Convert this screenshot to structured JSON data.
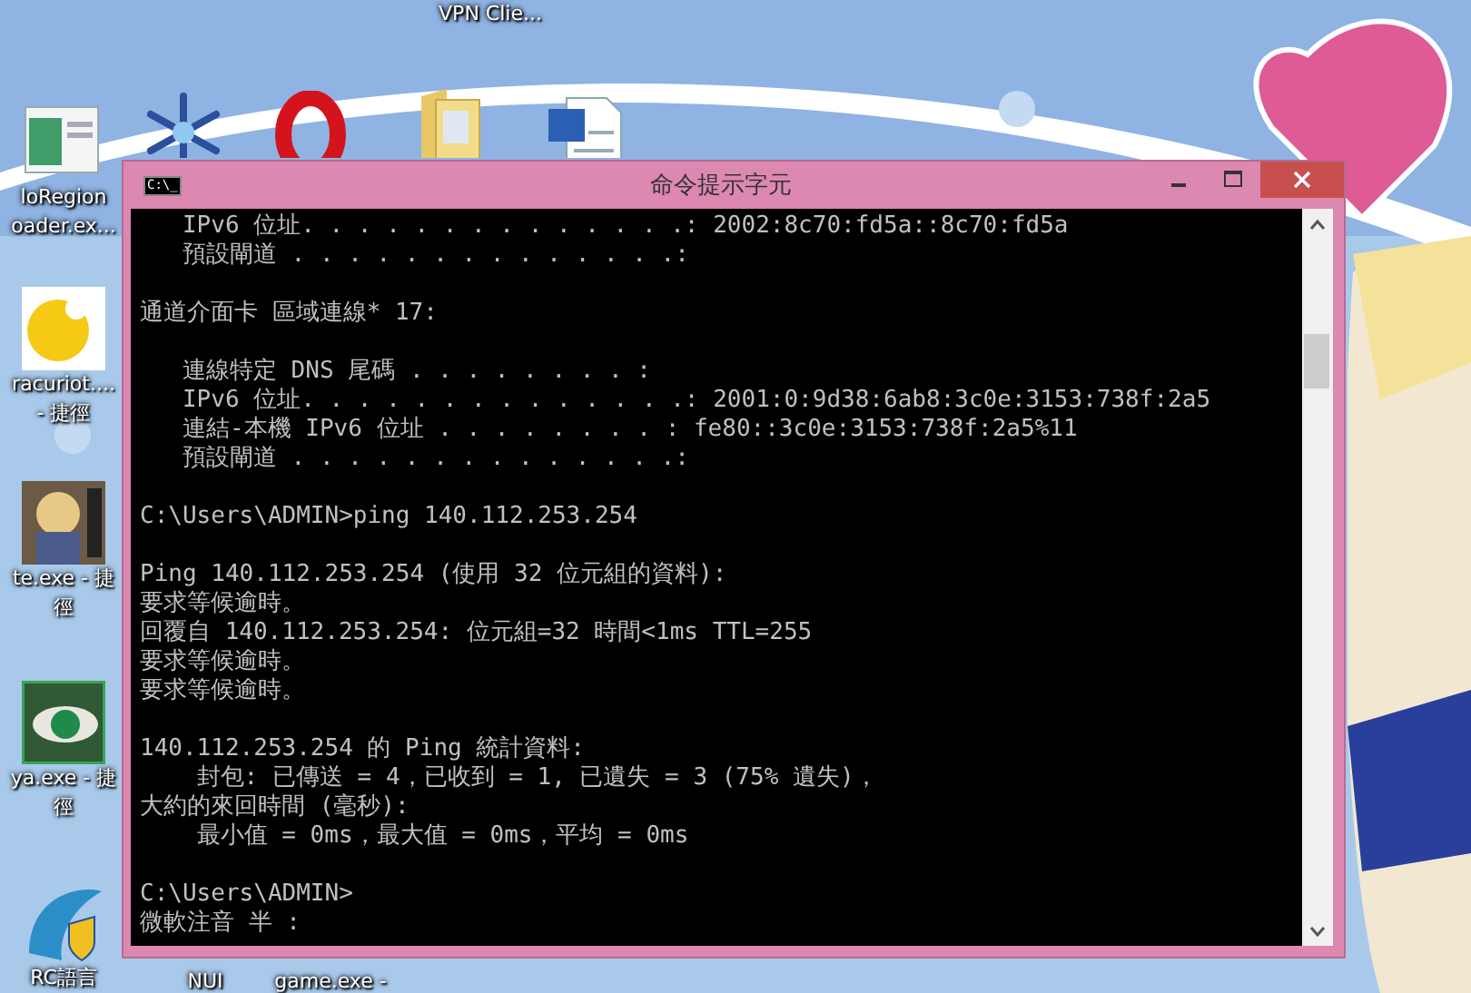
{
  "desktop": {
    "icons": [
      {
        "kind": "none",
        "label": [
          "VPN Clie..."
        ]
      },
      {
        "kind": "window",
        "label": [
          "loRegion",
          "oader.ex..."
        ]
      },
      {
        "kind": "snowflake"
      },
      {
        "kind": "ring"
      },
      {
        "kind": "folder"
      },
      {
        "kind": "document"
      },
      {
        "kind": "orange",
        "label": [
          "racuriot....",
          "- 捷徑"
        ]
      },
      {
        "kind": "portrait",
        "label": [
          "te.exe - 捷",
          "徑"
        ]
      },
      {
        "kind": "eye",
        "label": [
          "ya.exe - 捷",
          "徑"
        ]
      },
      {
        "kind": "shield",
        "label": [
          "RC語言"
        ]
      },
      {
        "kind": "none",
        "label": [
          "NUI"
        ]
      },
      {
        "kind": "none",
        "label": [
          "game.exe -"
        ]
      }
    ]
  },
  "window": {
    "title": "命令提示字元",
    "icon_text": "C:\\_",
    "console": {
      "blocks": [
        [
          "   IPv6 位址. . . . . . . . . . . . . .: 2002:8c70:fd5a::8c70:fd5a",
          "   預設閘道 . . . . . . . . . . . . . .:"
        ],
        [
          "通道介面卡 區域連線* 17:"
        ],
        [
          "   連線特定 DNS 尾碼 . . . . . . . . :",
          "   IPv6 位址. . . . . . . . . . . . . .: 2001:0:9d38:6ab8:3c0e:3153:738f:2a5",
          "   連結-本機 IPv6 位址 . . . . . . . . : fe80::3c0e:3153:738f:2a5%11",
          "   預設閘道 . . . . . . . . . . . . . .:"
        ],
        [
          "C:\\Users\\ADMIN>ping 140.112.253.254"
        ],
        [
          "Ping 140.112.253.254 (使用 32 位元組的資料):",
          "要求等候逾時。",
          "回覆自 140.112.253.254: 位元組=32 時間<1ms TTL=255",
          "要求等候逾時。",
          "要求等候逾時。"
        ],
        [
          "140.112.253.254 的 Ping 統計資料:",
          "    封包: 已傳送 = 4，已收到 = 1, 已遺失 = 3 (75% 遺失)，",
          "大約的來回時間 (毫秒):",
          "    最小值 = 0ms，最大值 = 0ms，平均 = 0ms"
        ],
        [
          "C:\\Users\\ADMIN>"
        ]
      ],
      "ime_status": "微軟注音 半 :"
    }
  }
}
